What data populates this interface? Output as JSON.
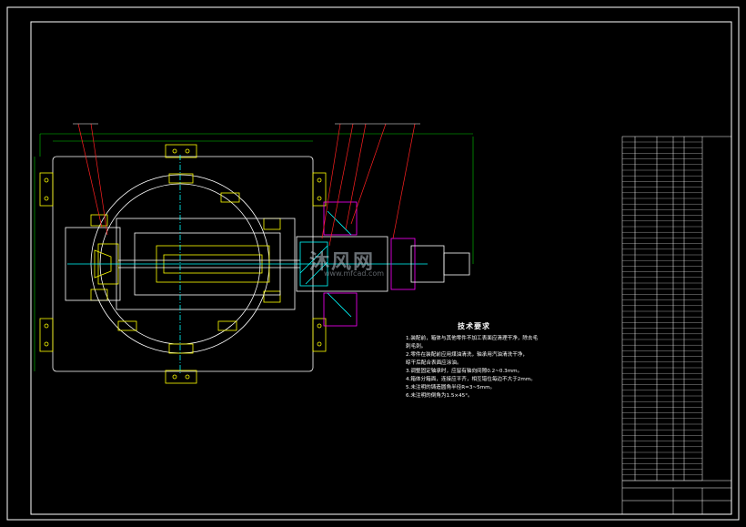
{
  "drawing": {
    "technical_requirements": {
      "title": "技术要求",
      "items": [
        "1.装配前，箱体与其他零件不加工表面应清理干净，除去毛",
        "  刺毛刺。",
        "2.零件在装配前应用煤油清洗，轴承用汽油清洗干净，",
        "  晾干后配合表面应涂油。",
        "3.调整固定轴承时，应留有轴向间隙0.2~0.3mm。",
        "4.箱体分箱面，连接应平齐，相互错位每边不大于2mm。",
        "5.未注明的铸造圆角半径R=3~5mm。",
        "6.未注明的倒角为1.5×45°。"
      ]
    },
    "watermark": {
      "text": "沐风网",
      "url": "www.mfcad.com"
    },
    "colors": {
      "background": "#000000",
      "line": "#ffffff",
      "accent_yellow": "#ffff00",
      "accent_cyan": "#00ffff",
      "accent_green": "#00cc00",
      "accent_red": "#ff2020",
      "accent_magenta": "#ff00ff"
    }
  }
}
